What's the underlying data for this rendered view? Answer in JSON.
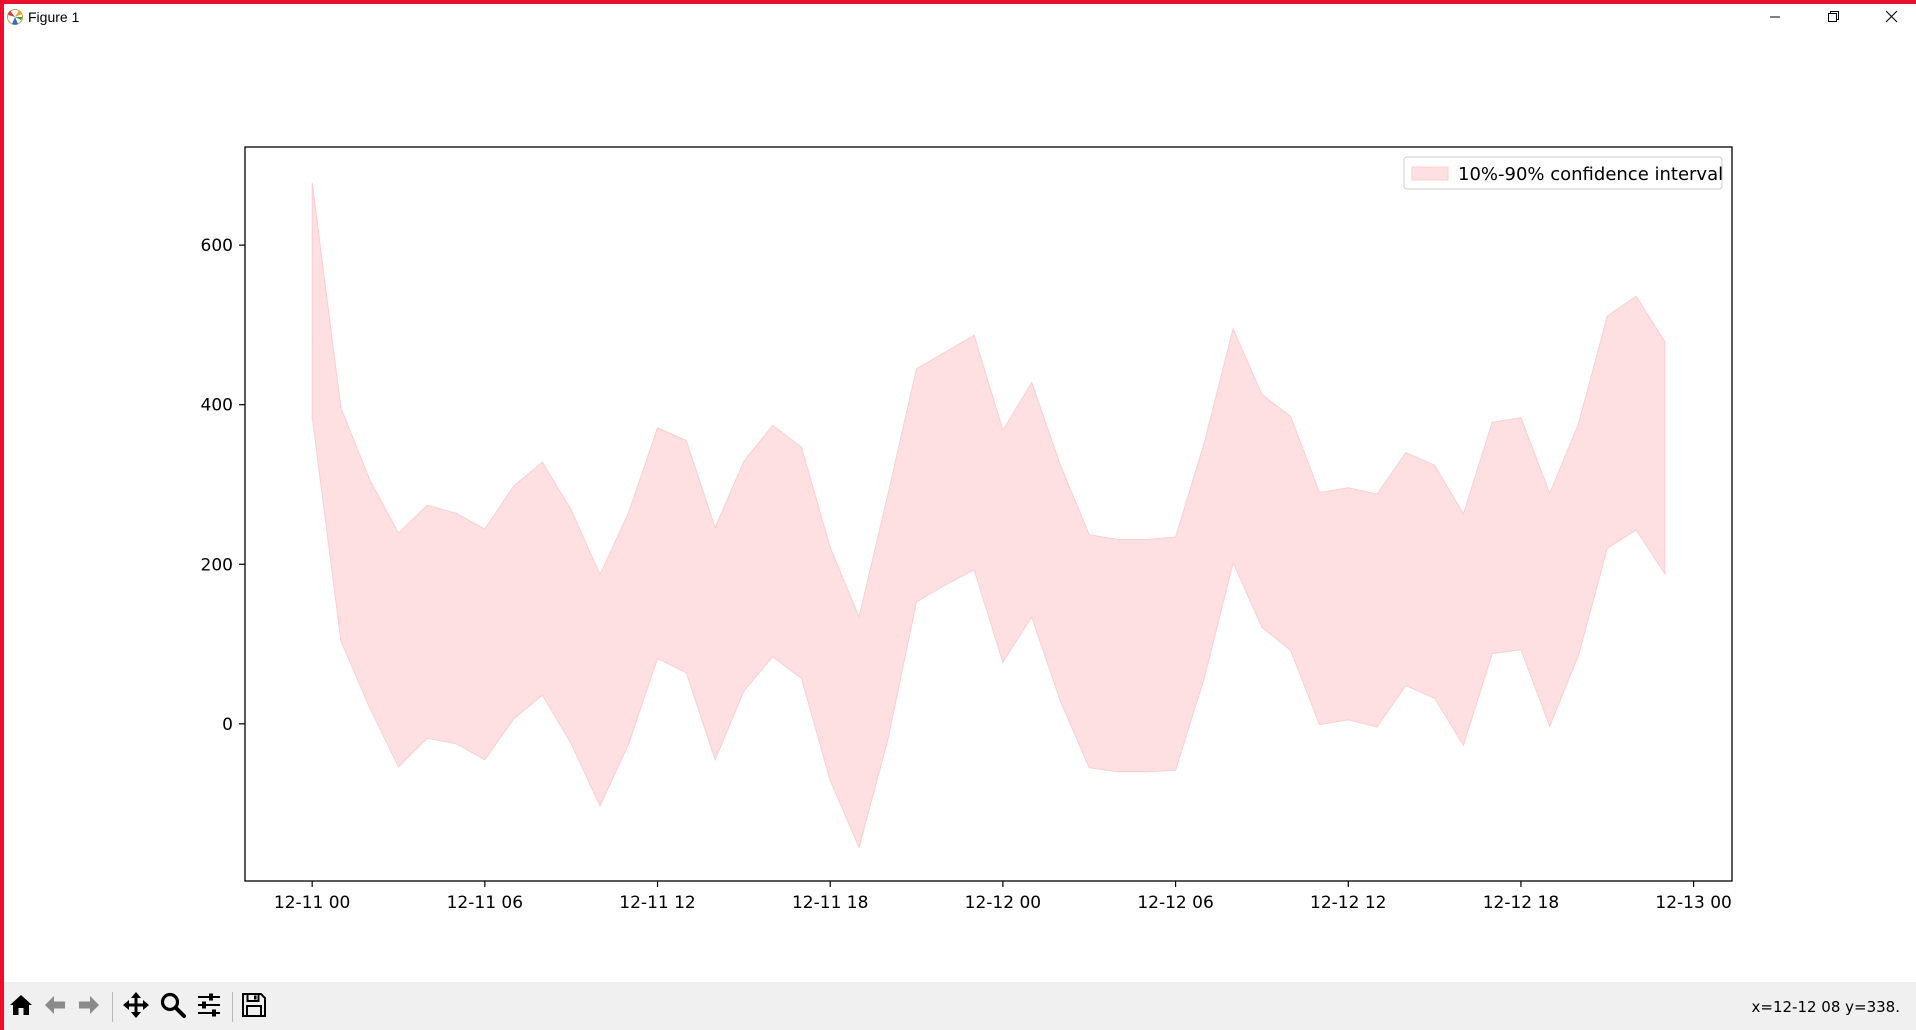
{
  "window": {
    "title": "Figure 1",
    "controls": [
      "minimize-icon",
      "restore-icon",
      "close-icon"
    ]
  },
  "toolbar": {
    "buttons": [
      "home-icon",
      "back-icon",
      "forward-icon",
      "pan-icon",
      "zoom-icon",
      "configure-subplots-icon",
      "save-icon"
    ],
    "coords": "x=12-12 08 y=338."
  },
  "colors": {
    "fill": "#ffe0e2",
    "fill_edge": "#ffcdd1",
    "frame": "#000000",
    "accent": "#e8112d"
  },
  "chart_data": {
    "type": "area",
    "title": "",
    "xlabel": "",
    "ylabel": "",
    "x_axis": "datetime",
    "xlim": [
      "2024-12-10 21:40",
      "2024-12-13 01:20"
    ],
    "ylim": [
      -197,
      723
    ],
    "xticks": [
      "12-11 00",
      "12-11 06",
      "12-11 12",
      "12-11 18",
      "12-12 00",
      "12-12 06",
      "12-12 12",
      "12-12 18",
      "12-13 00"
    ],
    "yticks": [
      0,
      200,
      400,
      600
    ],
    "grid": false,
    "legend": {
      "position": "upper-right",
      "entries": [
        "10%-90% confidence interval"
      ]
    },
    "series": [
      {
        "name": "10%-90% confidence interval",
        "x": [
          "2024-12-11 00:00",
          "2024-12-11 01:00",
          "2024-12-11 02:00",
          "2024-12-11 03:00",
          "2024-12-11 04:00",
          "2024-12-11 05:00",
          "2024-12-11 06:00",
          "2024-12-11 07:00",
          "2024-12-11 08:00",
          "2024-12-11 09:00",
          "2024-12-11 10:00",
          "2024-12-11 11:00",
          "2024-12-11 12:00",
          "2024-12-11 13:00",
          "2024-12-11 14:00",
          "2024-12-11 15:00",
          "2024-12-11 16:00",
          "2024-12-11 17:00",
          "2024-12-11 18:00",
          "2024-12-11 19:00",
          "2024-12-11 20:00",
          "2024-12-11 21:00",
          "2024-12-11 22:00",
          "2024-12-11 23:00",
          "2024-12-12 00:00",
          "2024-12-12 01:00",
          "2024-12-12 02:00",
          "2024-12-12 03:00",
          "2024-12-12 04:00",
          "2024-12-12 05:00",
          "2024-12-12 06:00",
          "2024-12-12 07:00",
          "2024-12-12 08:00",
          "2024-12-12 09:00",
          "2024-12-12 10:00",
          "2024-12-12 11:00",
          "2024-12-12 12:00",
          "2024-12-12 13:00",
          "2024-12-12 14:00",
          "2024-12-12 15:00",
          "2024-12-12 16:00",
          "2024-12-12 17:00",
          "2024-12-12 18:00",
          "2024-12-12 19:00",
          "2024-12-12 20:00",
          "2024-12-12 21:00",
          "2024-12-12 22:00",
          "2024-12-12 23:00"
        ],
        "lower": [
          385,
          104,
          20,
          -54,
          -18,
          -25,
          -45,
          6,
          36,
          -25,
          -103,
          -25,
          82,
          64,
          -45,
          41,
          84,
          57,
          -71,
          -155,
          -20,
          153,
          174,
          193,
          77,
          134,
          28,
          -55,
          -60,
          -60,
          -58,
          58,
          202,
          121,
          92,
          -1,
          5,
          -4,
          48,
          32,
          -27,
          88,
          93,
          -3,
          86,
          220,
          243,
          188
        ],
        "upper": [
          678,
          396,
          306,
          239,
          274,
          264,
          244,
          298,
          328,
          268,
          187,
          265,
          371,
          355,
          246,
          329,
          374,
          347,
          221,
          134,
          287,
          445,
          466,
          487,
          368,
          428,
          324,
          237,
          231,
          231,
          234,
          353,
          495,
          413,
          385,
          290,
          296,
          288,
          340,
          324,
          263,
          378,
          384,
          289,
          376,
          511,
          536,
          479
        ]
      }
    ]
  }
}
